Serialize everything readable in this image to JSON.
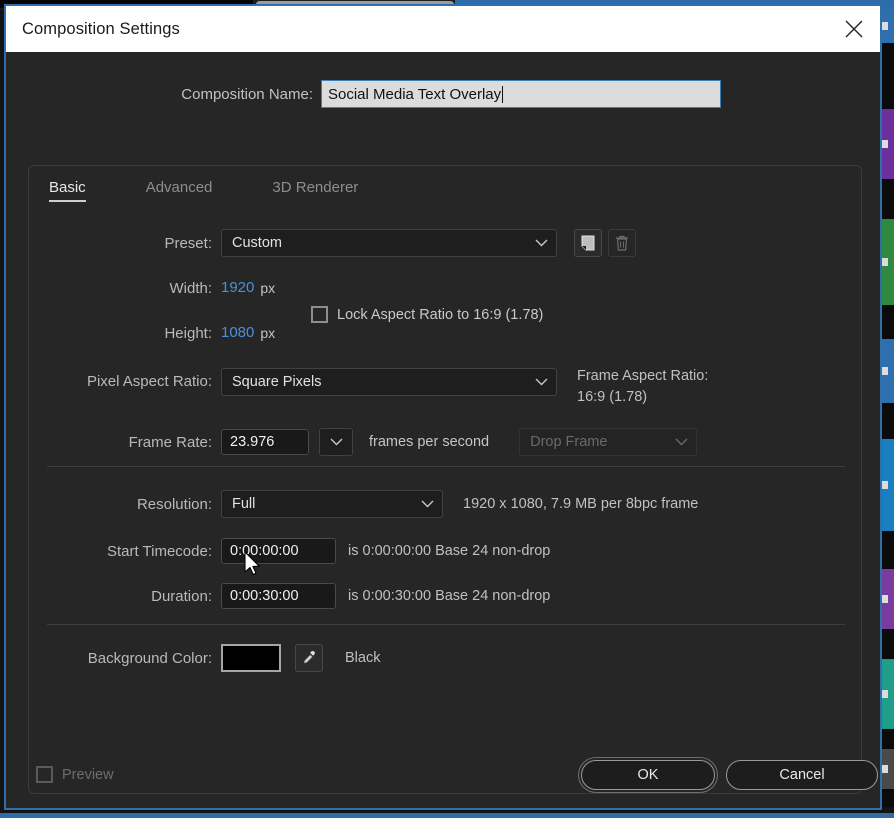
{
  "window": {
    "title": "Composition Settings",
    "close_icon": "close-icon"
  },
  "composition_name": {
    "label": "Composition Name:",
    "value": "Social Media Text Overlay"
  },
  "tabs": [
    {
      "label": "Basic",
      "active": true
    },
    {
      "label": "Advanced",
      "active": false
    },
    {
      "label": "3D Renderer",
      "active": false
    }
  ],
  "preset": {
    "label": "Preset:",
    "value": "Custom",
    "save_icon": "save-preset-icon",
    "delete_icon": "trash-icon"
  },
  "width": {
    "label": "Width:",
    "value": "1920",
    "unit": "px"
  },
  "height": {
    "label": "Height:",
    "value": "1080",
    "unit": "px"
  },
  "lock_aspect": {
    "label": "Lock Aspect Ratio to 16:9 (1.78)",
    "checked": false
  },
  "pixel_aspect_ratio": {
    "label": "Pixel Aspect Ratio:",
    "value": "Square Pixels"
  },
  "frame_aspect_ratio": {
    "label": "Frame Aspect Ratio:",
    "value": "16:9 (1.78)"
  },
  "frame_rate": {
    "label": "Frame Rate:",
    "value": "23.976",
    "unit": "frames per second",
    "drop_frame": "Drop Frame"
  },
  "resolution": {
    "label": "Resolution:",
    "value": "Full",
    "info": "1920 x 1080, 7.9 MB per 8bpc frame"
  },
  "start_timecode": {
    "label": "Start Timecode:",
    "value": "0:00:00:00",
    "info": "is 0:00:00:00  Base 24  non-drop"
  },
  "duration": {
    "label": "Duration:",
    "value": "0:00:30:00",
    "info": "is 0:00:30:00  Base 24  non-drop"
  },
  "background_color": {
    "label": "Background Color:",
    "swatch": "#000000",
    "eyedropper_icon": "eyedropper-icon",
    "name": "Black"
  },
  "footer": {
    "preview_label": "Preview",
    "preview_checked": false,
    "ok_label": "OK",
    "cancel_label": "Cancel"
  },
  "theme": {
    "accent": "#4a90d9",
    "window_border": "#2f6fae",
    "dialog_bg": "#262626",
    "titlebar_bg": "#ffffff"
  },
  "background_app": {
    "layer_colors": [
      "#6b2f9e",
      "#2f8a3f",
      "#2f6fae",
      "#1a7fc1",
      "#7a3a9e",
      "#1f9e8a"
    ]
  }
}
